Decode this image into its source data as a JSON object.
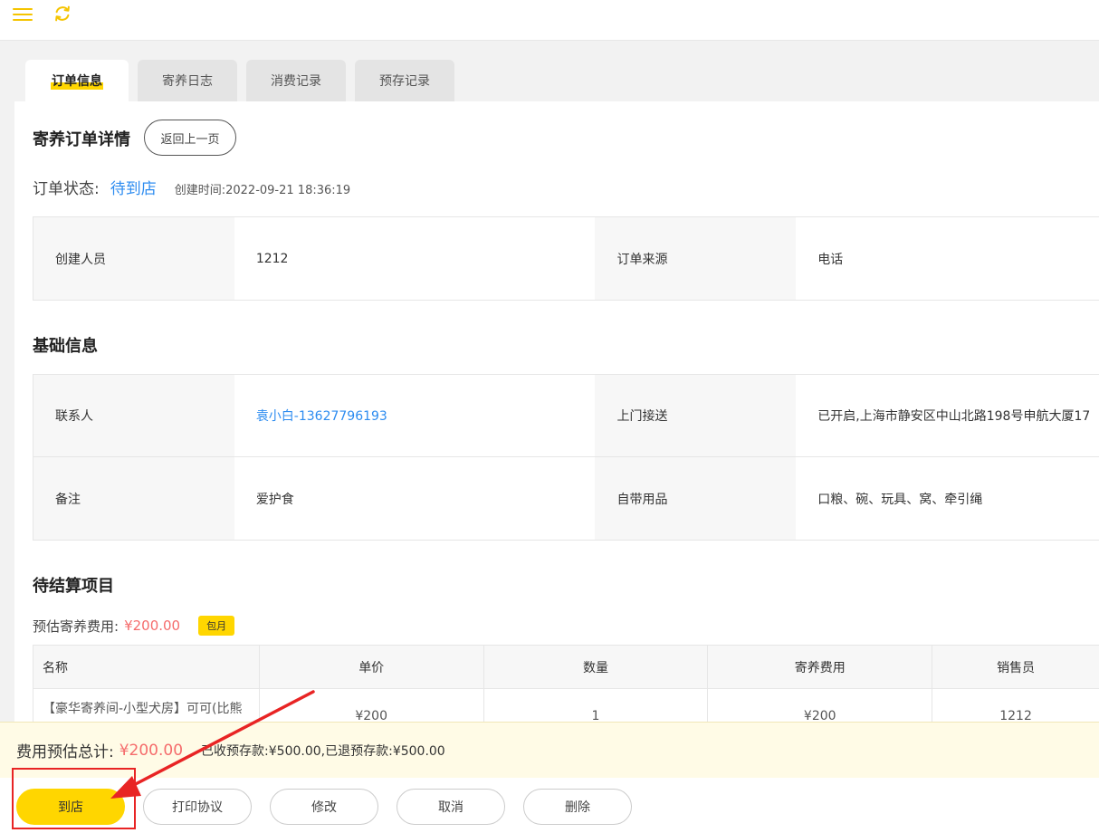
{
  "tabs": [
    {
      "label": "订单信息",
      "active": true
    },
    {
      "label": "寄养日志",
      "active": false
    },
    {
      "label": "消费记录",
      "active": false
    },
    {
      "label": "预存记录",
      "active": false
    }
  ],
  "detail": {
    "title": "寄养订单详情",
    "back_label": "返回上一页",
    "status_label": "订单状态:",
    "status_value": "待到店",
    "created_time": "创建时间:2022-09-21 18:36:19"
  },
  "order_info": {
    "creator_label": "创建人员",
    "creator_value": "1212",
    "source_label": "订单来源",
    "source_value": "电话"
  },
  "basic": {
    "title": "基础信息",
    "contact_label": "联系人",
    "contact_value": "袁小白-13627796193",
    "pickup_label": "上门接送",
    "pickup_value": "已开启,上海市静安区中山北路198号申航大厦17",
    "remark_label": "备注",
    "remark_value": "爱护食",
    "items_label": "自带用品",
    "items_value": "口粮、碗、玩具、窝、牵引绳"
  },
  "pending": {
    "title": "待结算项目",
    "fee_label": "预估寄养费用:",
    "fee_value": "¥200.00",
    "badge": "包月",
    "columns": [
      "名称",
      "单价",
      "数量",
      "寄养费用",
      "销售员"
    ],
    "row": {
      "name": "【豪华寄养间-小型犬房】可可(比熊",
      "price": "¥200",
      "qty": "1",
      "fee": "¥200",
      "seller": "1212"
    }
  },
  "footer": {
    "total_label": "费用预估总计:",
    "total_value": "¥200.00",
    "deposit_text": "已收预存款:¥500.00,已退预存款:¥500.00",
    "buttons": [
      "到店",
      "打印协议",
      "修改",
      "取消",
      "删除"
    ]
  },
  "colors": {
    "accent": "#ffd600",
    "link": "#2d8cf0",
    "price": "#f56c6c",
    "annotation": "#e82424"
  }
}
